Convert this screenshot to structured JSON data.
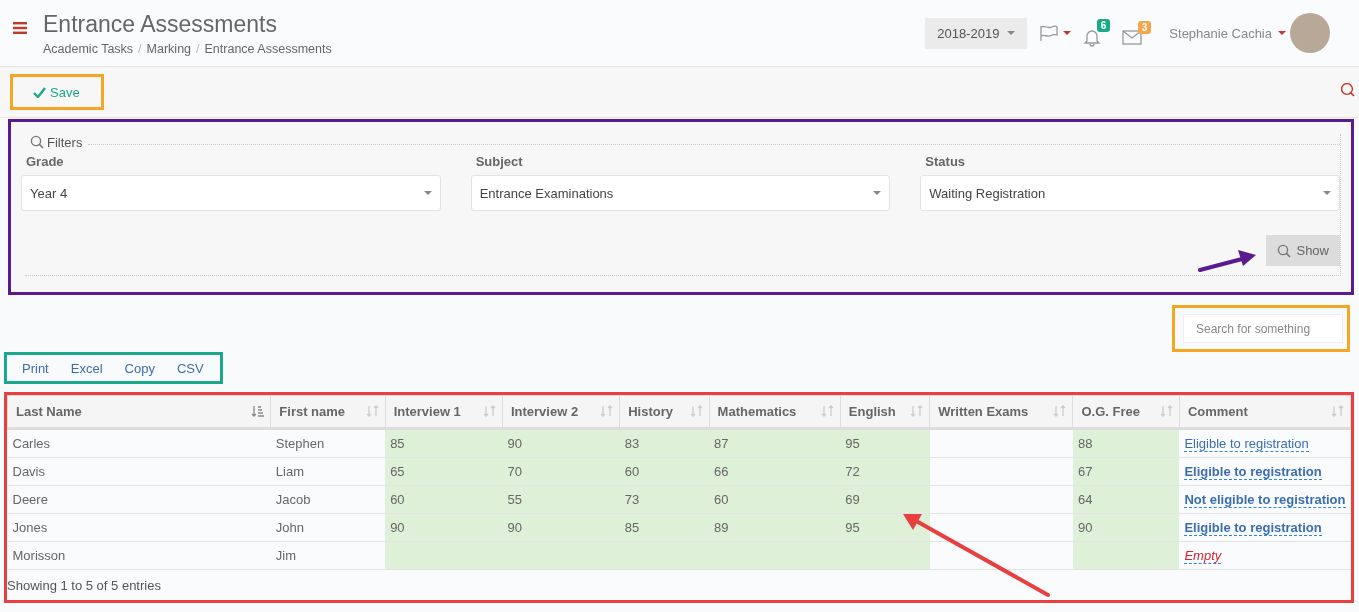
{
  "header": {
    "title": "Entrance Assessments",
    "breadcrumb": [
      "Academic Tasks",
      "Marking",
      "Entrance Assessments"
    ],
    "breadcrumb_separator": "/",
    "year": "2018-2019",
    "notifications": {
      "count": "6"
    },
    "messages": {
      "count": "3"
    },
    "user": {
      "name": "Stephanie Cachia"
    }
  },
  "toolbar": {
    "save": "Save"
  },
  "filters": {
    "legend": "Filters",
    "fields": [
      {
        "label": "Grade",
        "value": "Year 4"
      },
      {
        "label": "Subject",
        "value": "Entrance Examinations"
      },
      {
        "label": "Status",
        "value": "Waiting Registration"
      }
    ],
    "show": "Show"
  },
  "search": {
    "placeholder": "Search for something"
  },
  "export_buttons": [
    "Print",
    "Excel",
    "Copy",
    "CSV"
  ],
  "table": {
    "columns": [
      {
        "label": "Last Name",
        "sorted": true,
        "highlighted": false
      },
      {
        "label": "First name",
        "sorted": false,
        "highlighted": false
      },
      {
        "label": "Interview 1",
        "sorted": false,
        "highlighted": true
      },
      {
        "label": "Interview 2",
        "sorted": false,
        "highlighted": true
      },
      {
        "label": "History",
        "sorted": false,
        "highlighted": true
      },
      {
        "label": "Mathematics",
        "sorted": false,
        "highlighted": true
      },
      {
        "label": "English",
        "sorted": false,
        "highlighted": true
      },
      {
        "label": "Written Exams",
        "sorted": false,
        "highlighted": false
      },
      {
        "label": "O.G. Free",
        "sorted": false,
        "highlighted": true
      },
      {
        "label": "Comment",
        "sorted": false,
        "highlighted": false
      }
    ],
    "rows": [
      {
        "cells": [
          "Carles",
          "Stephen",
          "85",
          "90",
          "83",
          "87",
          "95",
          null,
          "88"
        ],
        "comment": {
          "text": "Eligible to registration",
          "kind": "plain"
        }
      },
      {
        "cells": [
          "Davis",
          "Liam",
          "65",
          "70",
          "60",
          "66",
          "72",
          null,
          "67"
        ],
        "comment": {
          "text": "Eligible to registration",
          "kind": "strong"
        }
      },
      {
        "cells": [
          "Deere",
          "Jacob",
          "60",
          "55",
          "73",
          "60",
          "69",
          null,
          "64"
        ],
        "comment": {
          "text": "Not eligible to registration",
          "kind": "strong"
        }
      },
      {
        "cells": [
          "Jones",
          "John",
          "90",
          "90",
          "85",
          "89",
          "95",
          null,
          "90"
        ],
        "comment": {
          "text": "Eligible to registration",
          "kind": "strong"
        }
      },
      {
        "cells": [
          "Morisson",
          "Jim",
          null,
          null,
          null,
          null,
          null,
          null,
          null
        ],
        "comment": {
          "text": "Empty",
          "kind": "empty"
        }
      }
    ],
    "footer": "Showing 1 to 5 of 5 entries"
  }
}
